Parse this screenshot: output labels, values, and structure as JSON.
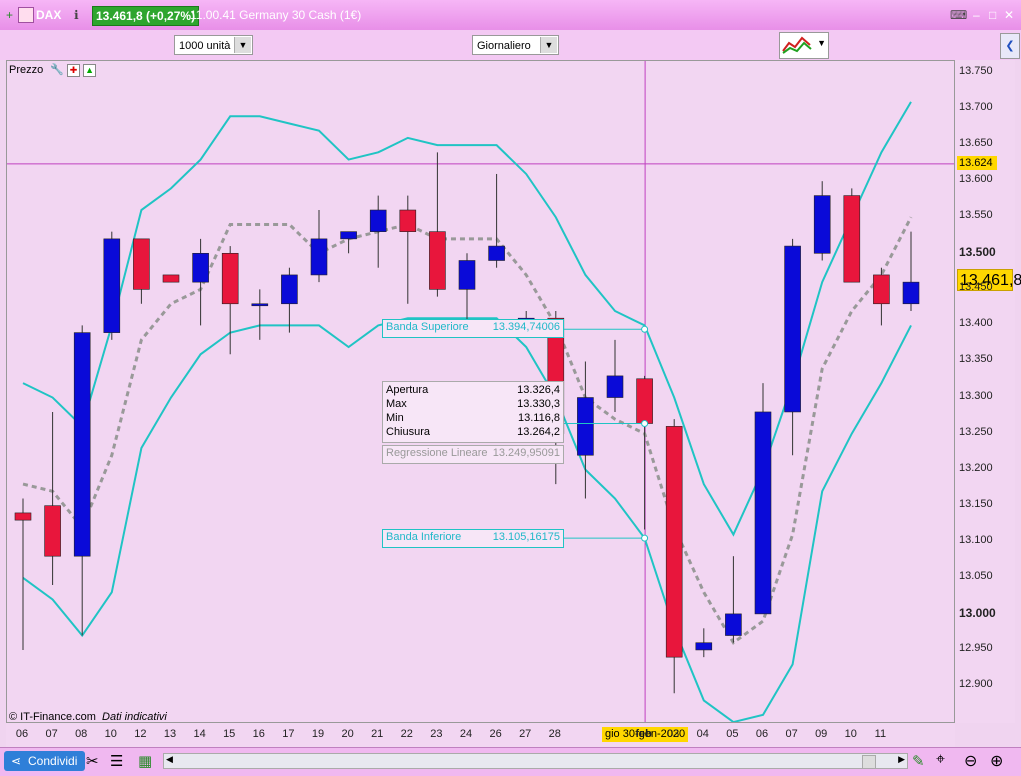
{
  "titlebar": {
    "symbol": "DAX",
    "price_badge": "13.461,8 (+0,27%)",
    "instrument": "11.00.41 Germany 30 Cash (1€)"
  },
  "toolbar": {
    "units_select": "1000 unità",
    "period_select": "Giornaliero"
  },
  "chart_header": {
    "label": "Prezzo"
  },
  "yaxis": {
    "ticks": [
      "13.750",
      "13.700",
      "13.650",
      "13.600",
      "13.550",
      "13.500",
      "13.450",
      "13.400",
      "13.350",
      "13.300",
      "13.250",
      "13.200",
      "13.150",
      "13.100",
      "13.050",
      "13.000",
      "12.950",
      "12.900"
    ],
    "bold": [
      "13.500",
      "13.000"
    ],
    "crosshair_label": "13.624",
    "last_price_label": "13.461,8"
  },
  "xaxis": {
    "ticks": [
      "06",
      "07",
      "08",
      "10",
      "12",
      "13",
      "14",
      "15",
      "16",
      "17",
      "19",
      "20",
      "21",
      "22",
      "23",
      "24",
      "26",
      "27",
      "28",
      "",
      "",
      "feb",
      "03",
      "04",
      "05",
      "06",
      "07",
      "09",
      "10",
      "11"
    ],
    "cursor_label": "gio 30-gen-2020"
  },
  "tooltips": {
    "upper": {
      "label": "Banda Superiore",
      "value": "13.394,74006"
    },
    "lower": {
      "label": "Banda Inferiore",
      "value": "13.105,16175"
    },
    "regression": {
      "label": "Regressione Lineare",
      "value": "13.249,95091"
    },
    "ohlc": [
      {
        "label": "Apertura",
        "value": "13.326,4"
      },
      {
        "label": "Max",
        "value": "13.330,3"
      },
      {
        "label": "Min",
        "value": "13.116,8"
      },
      {
        "label": "Chiusura",
        "value": "13.264,2"
      }
    ]
  },
  "footer": {
    "copyright": "© IT-Finance.com",
    "note": "Dati indicativi"
  },
  "bottombar": {
    "share_label": "Condividi"
  },
  "colors": {
    "up": "#0a0ad8",
    "down": "#e8163c",
    "band": "#20c4c4",
    "regression": "#999999"
  },
  "chart_data": {
    "type": "candlestick",
    "ylim": [
      12.87,
      13.78
    ],
    "candles": [
      {
        "o": 13.14,
        "h": 13.16,
        "l": 12.95,
        "c": 13.13
      },
      {
        "o": 13.15,
        "h": 13.28,
        "l": 13.04,
        "c": 13.08
      },
      {
        "o": 13.08,
        "h": 13.4,
        "l": 12.97,
        "c": 13.39
      },
      {
        "o": 13.39,
        "h": 13.53,
        "l": 13.38,
        "c": 13.52
      },
      {
        "o": 13.52,
        "h": 13.52,
        "l": 13.43,
        "c": 13.45
      },
      {
        "o": 13.47,
        "h": 13.47,
        "l": 13.46,
        "c": 13.46
      },
      {
        "o": 13.46,
        "h": 13.52,
        "l": 13.4,
        "c": 13.5
      },
      {
        "o": 13.5,
        "h": 13.51,
        "l": 13.36,
        "c": 13.43
      },
      {
        "o": 13.43,
        "h": 13.45,
        "l": 13.38,
        "c": 13.43
      },
      {
        "o": 13.43,
        "h": 13.48,
        "l": 13.39,
        "c": 13.47
      },
      {
        "o": 13.47,
        "h": 13.56,
        "l": 13.46,
        "c": 13.52
      },
      {
        "o": 13.52,
        "h": 13.53,
        "l": 13.5,
        "c": 13.53
      },
      {
        "o": 13.53,
        "h": 13.58,
        "l": 13.48,
        "c": 13.56
      },
      {
        "o": 13.56,
        "h": 13.58,
        "l": 13.43,
        "c": 13.53
      },
      {
        "o": 13.53,
        "h": 13.64,
        "l": 13.44,
        "c": 13.45
      },
      {
        "o": 13.45,
        "h": 13.5,
        "l": 13.39,
        "c": 13.49
      },
      {
        "o": 13.49,
        "h": 13.61,
        "l": 13.48,
        "c": 13.51
      },
      {
        "o": 13.41,
        "h": 13.42,
        "l": 13.4,
        "c": 13.41
      },
      {
        "o": 13.41,
        "h": 13.42,
        "l": 13.18,
        "c": 13.25
      },
      {
        "o": 13.22,
        "h": 13.35,
        "l": 13.16,
        "c": 13.3
      },
      {
        "o": 13.3,
        "h": 13.38,
        "l": 13.28,
        "c": 13.33
      },
      {
        "o": 13.326,
        "h": 13.33,
        "l": 13.117,
        "c": 13.264
      },
      {
        "o": 13.26,
        "h": 13.27,
        "l": 12.89,
        "c": 12.94
      },
      {
        "o": 12.95,
        "h": 12.98,
        "l": 12.94,
        "c": 12.96
      },
      {
        "o": 12.97,
        "h": 13.08,
        "l": 12.96,
        "c": 13.0
      },
      {
        "o": 13.0,
        "h": 13.32,
        "l": 13.0,
        "c": 13.28
      },
      {
        "o": 13.28,
        "h": 13.52,
        "l": 13.22,
        "c": 13.51
      },
      {
        "o": 13.5,
        "h": 13.6,
        "l": 13.49,
        "c": 13.58
      },
      {
        "o": 13.58,
        "h": 13.59,
        "l": 13.46,
        "c": 13.46
      },
      {
        "o": 13.47,
        "h": 13.48,
        "l": 13.4,
        "c": 13.43
      },
      {
        "o": 13.43,
        "h": 13.53,
        "l": 13.42,
        "c": 13.46
      }
    ],
    "upper_band": [
      13.32,
      13.3,
      13.26,
      13.4,
      13.56,
      13.59,
      13.63,
      13.69,
      13.69,
      13.68,
      13.67,
      13.63,
      13.64,
      13.66,
      13.65,
      13.65,
      13.65,
      13.61,
      13.55,
      13.47,
      13.42,
      13.4,
      13.3,
      13.18,
      13.11,
      13.2,
      13.32,
      13.46,
      13.55,
      13.64,
      13.71
    ],
    "lower_band": [
      13.05,
      13.02,
      12.97,
      13.03,
      13.23,
      13.3,
      13.36,
      13.39,
      13.4,
      13.4,
      13.4,
      13.37,
      13.4,
      13.41,
      13.41,
      13.41,
      13.41,
      13.37,
      13.3,
      13.2,
      13.16,
      13.105,
      12.98,
      12.88,
      12.85,
      12.86,
      12.93,
      13.17,
      13.25,
      13.32,
      13.4
    ],
    "regression": [
      13.18,
      13.17,
      13.12,
      13.22,
      13.38,
      13.43,
      13.45,
      13.54,
      13.54,
      13.54,
      13.5,
      13.52,
      13.53,
      13.54,
      13.52,
      13.52,
      13.52,
      13.47,
      13.4,
      13.3,
      13.27,
      13.25,
      13.12,
      13.03,
      12.96,
      12.99,
      13.11,
      13.34,
      13.42,
      13.47,
      13.55
    ]
  }
}
